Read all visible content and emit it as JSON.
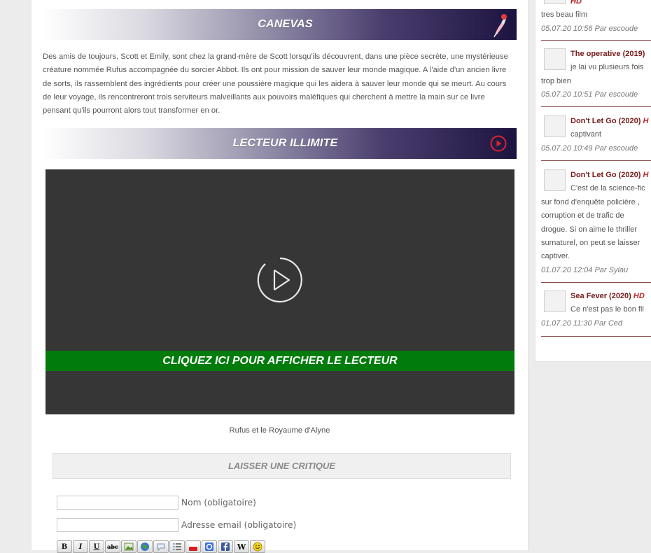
{
  "banners": {
    "canevas": "CANEVAS",
    "lecteur": "LECTEUR ILLIMITE"
  },
  "synopsis": "Des amis de toujours, Scott et Emily, sont chez la grand-mère de Scott lorsqu'ils découvrent, dans une pièce secrète, une mystérieuse créature nommée Rufus accompagnée du sorcier Abbot. Ils ont pour mission de sauver leur monde magique. A l'aide d'un ancien livre de sorts, ils rassemblent des ingrédients pour créer une poussière magique qui les aidera à sauver leur monde qui se meurt. Au cours de leur voyage, ils rencontreront trois serviteurs malveillants aux pouvoirs maléfiques qui cherchent à mettre la main sur ce livre pensant qu'ils pourront alors tout transformer en or.",
  "player": {
    "cta": "CLIQUEZ ICI POUR AFFICHER LE LECTEUR",
    "caption": "Rufus et le Royaume d'Alyne"
  },
  "review_form": {
    "header": "LAISSER UNE CRITIQUE",
    "name_label": "Nom (obligatoire)",
    "email_label": "Adresse email (obligatoire)",
    "name_value": "",
    "email_value": "",
    "toolbar": [
      "bold",
      "italic",
      "underline",
      "strike",
      "image",
      "link",
      "quote",
      "list",
      "youtube",
      "google",
      "facebook",
      "wikipedia",
      "smiley"
    ]
  },
  "sidebar": {
    "top_fragment": {
      "hd": "HD",
      "text": "tres beau film",
      "meta": "05.07.20 10:56 Par escoude"
    },
    "comments": [
      {
        "film": "The operative (2019)",
        "hd": "",
        "line1": "je lai vu plusieurs fois",
        "rest": "trop bien",
        "meta": "05.07.20 10:51 Par escoude"
      },
      {
        "film": "Don't Let Go (2020)",
        "hd": "H",
        "line1": "captivant",
        "rest": "",
        "meta": "05.07.20 10:49 Par escoude"
      },
      {
        "film": "Don't Let Go (2020)",
        "hd": "H",
        "line1": "C'est de la science-fic",
        "rest": "sur fond d'enquête policière , corruption et de trafic de drogue. Si on aime le thriller surnaturel, on peut se laisser captiver.",
        "meta": "01.07.20 12:04 Par Sylau"
      },
      {
        "film": "Sea Fever (2020)",
        "hd": "HD",
        "line1": "Ce n'est pas le bon fil",
        "rest": "",
        "meta": "01.07.20 11:30 Par Ced"
      }
    ]
  },
  "colors": {
    "cta_green": "#007b0c",
    "player_bg": "#363636",
    "film_title": "#7a1a1a",
    "hd_red": "#c0262c"
  }
}
